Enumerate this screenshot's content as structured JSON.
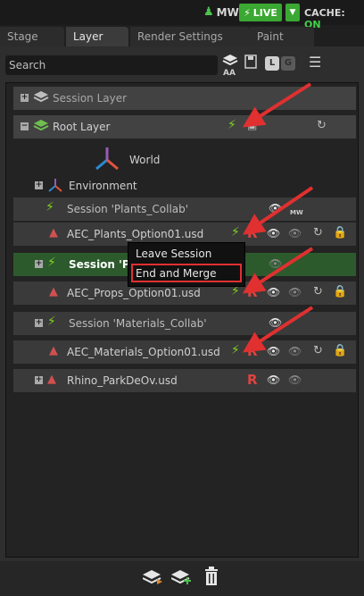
{
  "topbar": {
    "user": "MW",
    "live_label": "LIVE",
    "cache_label": "CACHE:",
    "cache_value": "ON"
  },
  "tabs": [
    {
      "label": "Stage"
    },
    {
      "label": "Layer"
    },
    {
      "label": "Render Settings"
    },
    {
      "label": "Paint"
    }
  ],
  "toolbar": {
    "search_placeholder": "Search",
    "aa_label": "AA",
    "l_label": "L",
    "g_label": "G"
  },
  "tree": {
    "session_layer": "Session Layer",
    "root_layer": "Root Layer",
    "world": "World",
    "environment": "Environment",
    "plants_session": "Session 'Plants_Collab'",
    "mw_badge": "MW",
    "plants_usd": "AEC_Plants_Option01.usd",
    "props_session": "Session 'Pro",
    "props_usd": "AEC_Props_Option01.usd",
    "materials_session": "Session 'Materials_Collab'",
    "materials_usd": "AEC_Materials_Option01.usd",
    "rhino_usd": "Rhino_ParkDeOv.usd",
    "r_label": "R"
  },
  "context_menu": {
    "leave": "Leave Session",
    "end_merge": "End and Merge"
  },
  "colors": {
    "live_green": "#3aa832",
    "bolt_green": "#7ed321",
    "annotation_red": "#e03030",
    "lock_blue": "#1e8cf0"
  }
}
